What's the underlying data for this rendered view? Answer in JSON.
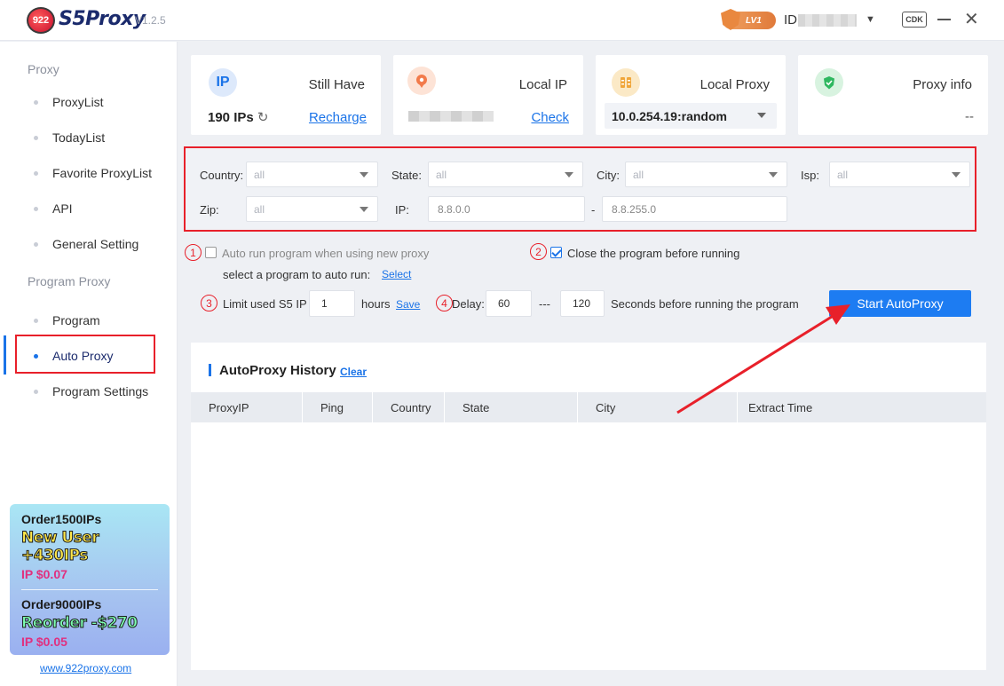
{
  "app": {
    "logo_text": "922",
    "brand": "S5Proxy",
    "version": "V1.2.5"
  },
  "header": {
    "level": "LV1",
    "id_label": "ID",
    "cdk": "CDK"
  },
  "sidebar": {
    "section_proxy": "Proxy",
    "proxy_items": [
      "ProxyList",
      "TodayList",
      "Favorite ProxyList",
      "API",
      "General Setting"
    ],
    "section_program": "Program Proxy",
    "program_items": [
      "Program",
      "Auto Proxy",
      "Program Settings"
    ],
    "active": "Auto Proxy"
  },
  "promo": {
    "offer1_title": "Order1500IPs",
    "offer1_bonus": "New User +430IPs",
    "offer1_price": "IP $0.07",
    "offer2_title": "Order9000IPs",
    "offer2_bonus": "Reorder -$270",
    "offer2_price": "IP $0.05",
    "site": "www.922proxy.com"
  },
  "cards": {
    "ip": {
      "icon": "IP",
      "title": "Still Have",
      "value": "190 IPs",
      "link": "Recharge"
    },
    "local_ip": {
      "title": "Local IP",
      "link": "Check"
    },
    "local_proxy": {
      "title": "Local Proxy",
      "selected": "10.0.254.19:random"
    },
    "proxy_info": {
      "title": "Proxy info",
      "value": "--"
    }
  },
  "filters": {
    "country_label": "Country:",
    "country_value": "all",
    "state_label": "State:",
    "state_value": "all",
    "city_label": "City:",
    "city_value": "all",
    "isp_label": "Isp:",
    "isp_value": "all",
    "zip_label": "Zip:",
    "zip_value": "all",
    "ip_label": "IP:",
    "ip_from": "8.8.0.0",
    "ip_sep": "-",
    "ip_to": "8.8.255.0"
  },
  "options": {
    "n1": "1",
    "n2": "2",
    "n3": "3",
    "n4": "4",
    "auto_run_label": "Auto run program when using new proxy",
    "select_program_label": "select a program to auto run:",
    "select_link": "Select",
    "close_before_label": "Close the program before running",
    "limit_label": "Limit used S5 IP",
    "limit_value": "1",
    "hours_label": "hours",
    "save_link": "Save",
    "delay_label": "Delay:",
    "delay_min": "60",
    "delay_sep": "---",
    "delay_max": "120",
    "seconds_label": "Seconds before running the program",
    "start_button": "Start AutoProxy"
  },
  "history": {
    "title": "AutoProxy History",
    "clear": "Clear",
    "columns": [
      "ProxyIP",
      "Ping",
      "Country",
      "State",
      "City",
      "Extract Time"
    ]
  },
  "colors": {
    "accent": "#1d7cf2",
    "annotation": "#e8202a"
  }
}
